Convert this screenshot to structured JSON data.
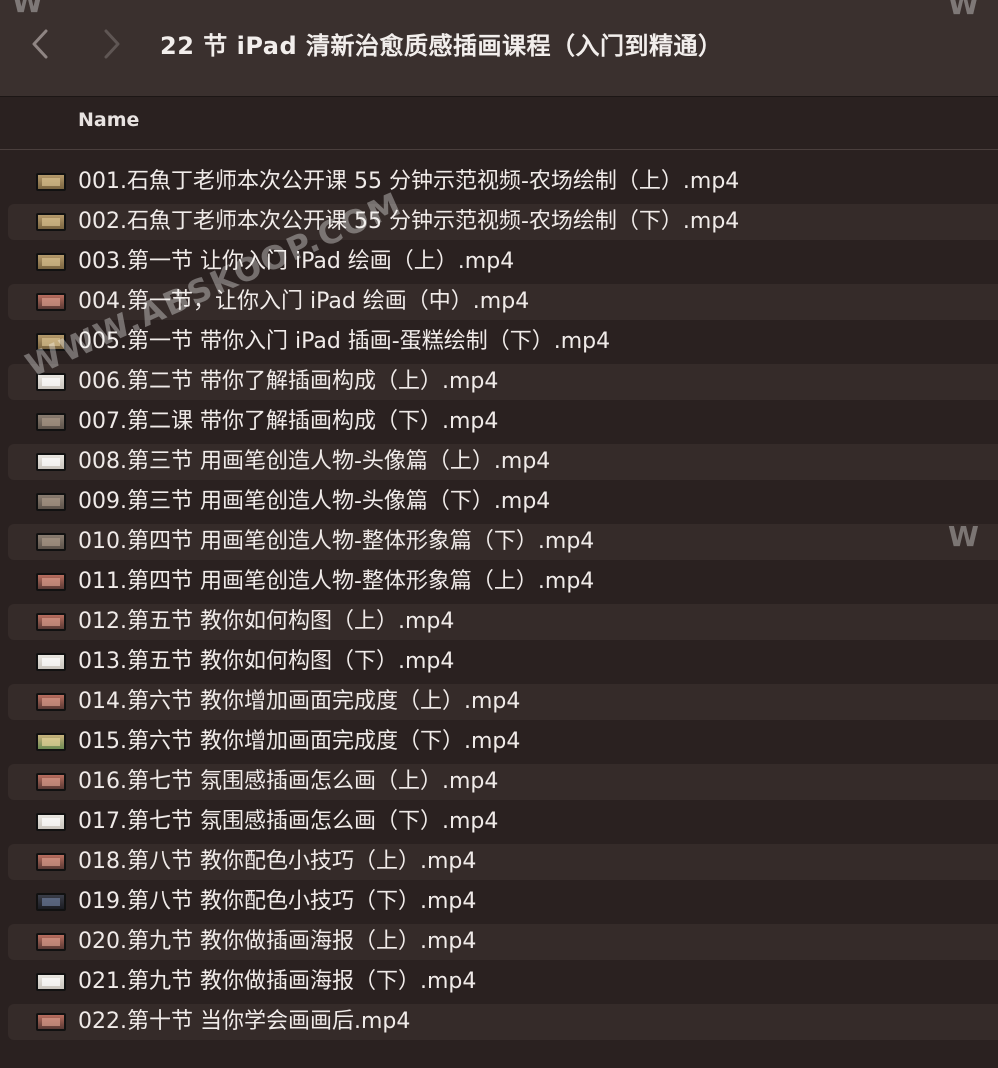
{
  "window": {
    "title": "22 节 iPad 清新治愈质感插画课程（入门到精通）",
    "back_icon": "chevron-left-icon",
    "forward_icon": "chevron-right-icon"
  },
  "columns": {
    "name": "Name"
  },
  "files": [
    {
      "name": "001.石魚丁老师本次公开课 55 分钟示范视频-农场绘制（上）.mp4",
      "thumb": "warm"
    },
    {
      "name": "002.石魚丁老师本次公开课 55 分钟示范视频-农场绘制（下）.mp4",
      "thumb": "warm"
    },
    {
      "name": "003.第一节 让你入门 iPad 绘画（上）.mp4",
      "thumb": "warm"
    },
    {
      "name": "004.第一节，让你入门 iPad 绘画（中）.mp4",
      "thumb": "red"
    },
    {
      "name": "005.第一节 带你入门 iPad 插画-蛋糕绘制（下）.mp4",
      "thumb": "warm"
    },
    {
      "name": "006.第二节 带你了解插画构成（上）.mp4",
      "thumb": "light"
    },
    {
      "name": "007.第二课 带你了解插画构成（下）.mp4",
      "thumb": "default"
    },
    {
      "name": "008.第三节 用画笔创造人物-头像篇（上）.mp4",
      "thumb": "light"
    },
    {
      "name": "009.第三节 用画笔创造人物-头像篇（下）.mp4",
      "thumb": "default"
    },
    {
      "name": "010.第四节 用画笔创造人物-整体形象篇（下）.mp4",
      "thumb": "default"
    },
    {
      "name": "011.第四节 用画笔创造人物-整体形象篇（上）.mp4",
      "thumb": "red"
    },
    {
      "name": "012.第五节 教你如何构图（上）.mp4",
      "thumb": "red"
    },
    {
      "name": "013.第五节 教你如何构图（下）.mp4",
      "thumb": "light"
    },
    {
      "name": "014.第六节 教你增加画面完成度（上）.mp4",
      "thumb": "red"
    },
    {
      "name": "015.第六节 教你增加画面完成度（下）.mp4",
      "thumb": "green"
    },
    {
      "name": "016.第七节 氛围感插画怎么画（上）.mp4",
      "thumb": "red"
    },
    {
      "name": "017.第七节 氛围感插画怎么画（下）.mp4",
      "thumb": "light"
    },
    {
      "name": "018.第八节 教你配色小技巧（上）.mp4",
      "thumb": "red"
    },
    {
      "name": "019.第八节 教你配色小技巧（下）.mp4",
      "thumb": "dark"
    },
    {
      "name": "020.第九节 教你做插画海报（上）.mp4",
      "thumb": "red"
    },
    {
      "name": "021.第九节 教你做插画海报（下）.mp4",
      "thumb": "light"
    },
    {
      "name": "022.第十节 当你学会画画后.mp4",
      "thumb": "red"
    }
  ],
  "watermarks": {
    "diagonal": "WWW.ABSKOOP.COM",
    "corner_left": "W",
    "corner_right": "W",
    "edge_right": "W"
  },
  "colors": {
    "background": "#2a2120",
    "titlebar": "#3a302e",
    "alt_row": "#352b29",
    "text": "#f0ebe9"
  }
}
